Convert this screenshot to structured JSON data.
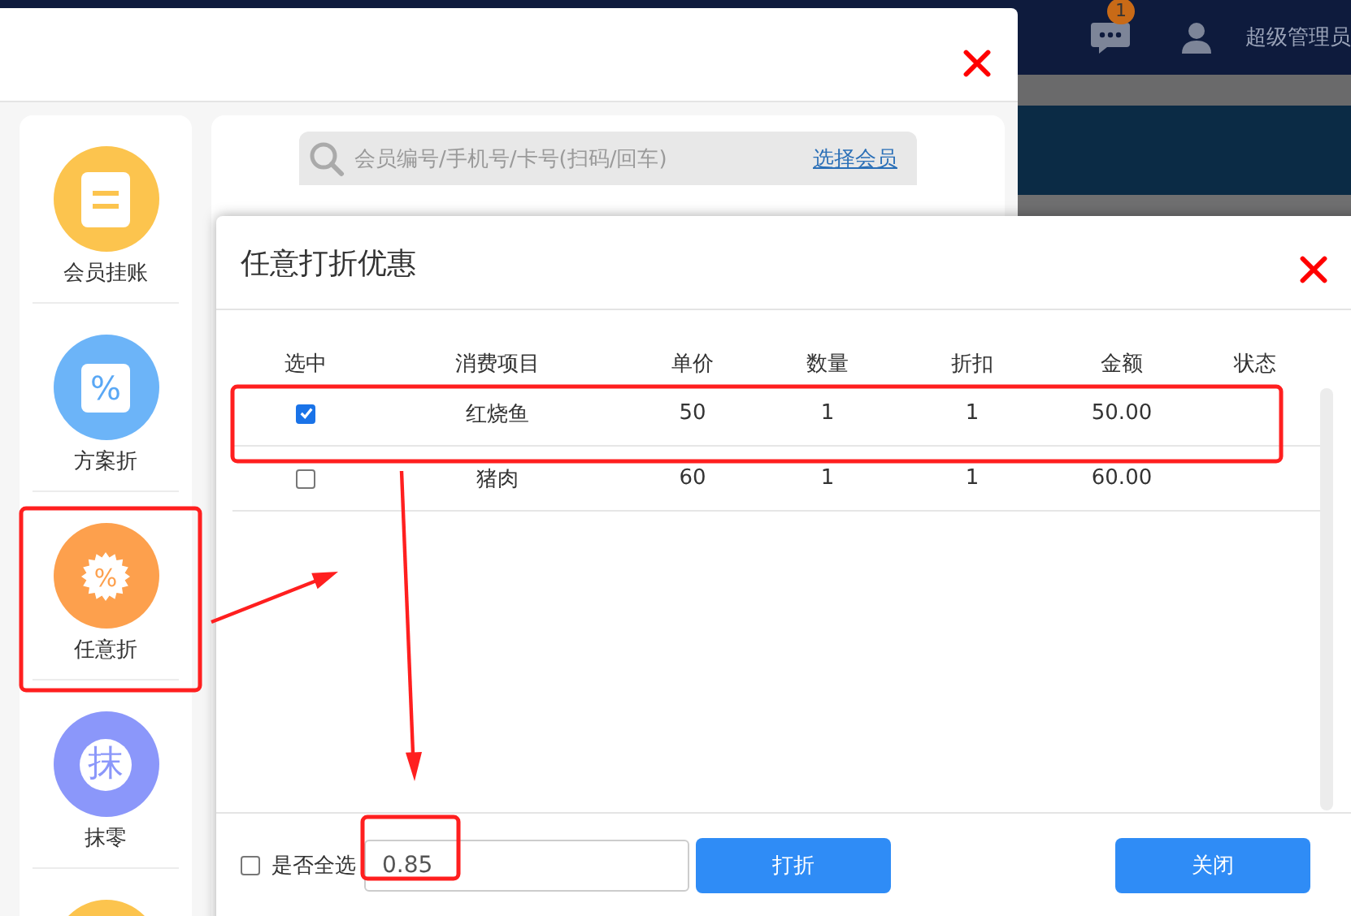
{
  "topbar": {
    "message_badge": "1",
    "user_name": "超级管理员"
  },
  "member_modal": {
    "sidebar": {
      "items": [
        {
          "kind": "ledger",
          "label": "会员挂账",
          "color": "#fcc44e"
        },
        {
          "kind": "percent",
          "glyph": "%",
          "label": "方案折",
          "color": "#6cb4f8"
        },
        {
          "kind": "badge",
          "glyph": "%",
          "label": "任意折",
          "color": "#fda04d"
        },
        {
          "kind": "glyph",
          "glyph": "抹",
          "label": "抹零",
          "color": "#8b97fa"
        },
        {
          "kind": "blank",
          "color": "#fcc44e"
        }
      ]
    },
    "search": {
      "placeholder": "会员编号/手机号/卡号(扫码/回车)",
      "link": "选择会员"
    }
  },
  "discount_dialog": {
    "title": "任意打折优惠",
    "columns": [
      "选中",
      "消费项目",
      "单价",
      "数量",
      "折扣",
      "金额",
      "状态"
    ],
    "rows": [
      {
        "checked": true,
        "item": "红烧鱼",
        "price": "50",
        "qty": "1",
        "discount": "1",
        "amount": "50.00"
      },
      {
        "checked": false,
        "item": "猪肉",
        "price": "60",
        "qty": "1",
        "discount": "1",
        "amount": "60.00"
      }
    ],
    "select_all": {
      "label": "是否全选",
      "checked": false
    },
    "discount_input": {
      "value": "0.85"
    },
    "buttons": [
      {
        "kind": "apply",
        "label": "打折"
      },
      {
        "kind": "close",
        "label": "关闭"
      }
    ]
  },
  "annotations": [
    {
      "kind": "box"
    },
    {
      "kind": "box"
    },
    {
      "kind": "box"
    },
    {
      "kind": "arrow"
    },
    {
      "kind": "arrow"
    }
  ]
}
